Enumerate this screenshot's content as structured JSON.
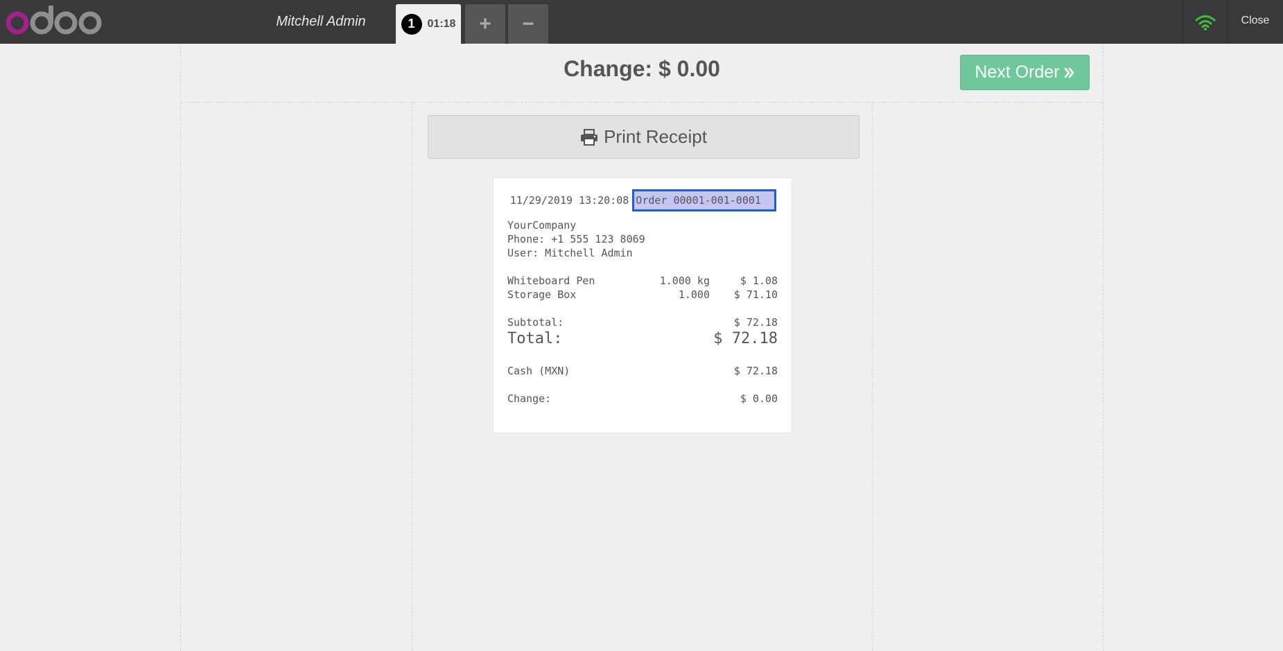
{
  "topbar": {
    "cashier": "Mitchell Admin",
    "order_tab": {
      "sequence": "1",
      "time": "01:18"
    },
    "add_tab": "+",
    "remove_tab": "−",
    "close": "Close",
    "colors": {
      "bar": "#393939",
      "wifi": "#3fc03f",
      "logo_o": "#a0228a",
      "logo_rest": "#8f8f8f"
    }
  },
  "screen": {
    "change_title": "Change: $ 0.00",
    "next_order": "Next Order",
    "print_receipt": "Print Receipt"
  },
  "receipt": {
    "date": "11/29/2019 13:20:08",
    "order_ref": "Order 00001-001-0001",
    "company": "YourCompany",
    "phone": "Phone: +1 555 123 8069",
    "user": "User: Mitchell Admin",
    "lines": [
      {
        "product": "Whiteboard Pen",
        "qty": "1.000 kg",
        "price": "$ 1.08"
      },
      {
        "product": "Storage Box",
        "qty": "1.000",
        "price": "$ 71.10"
      }
    ],
    "subtotal_label": "Subtotal:",
    "subtotal_value": "$ 72.18",
    "total_label": "Total:",
    "total_value": "$ 72.18",
    "payment_label": "Cash (MXN)",
    "payment_value": "$ 72.18",
    "change_label": "Change:",
    "change_value": "$ 0.00"
  }
}
